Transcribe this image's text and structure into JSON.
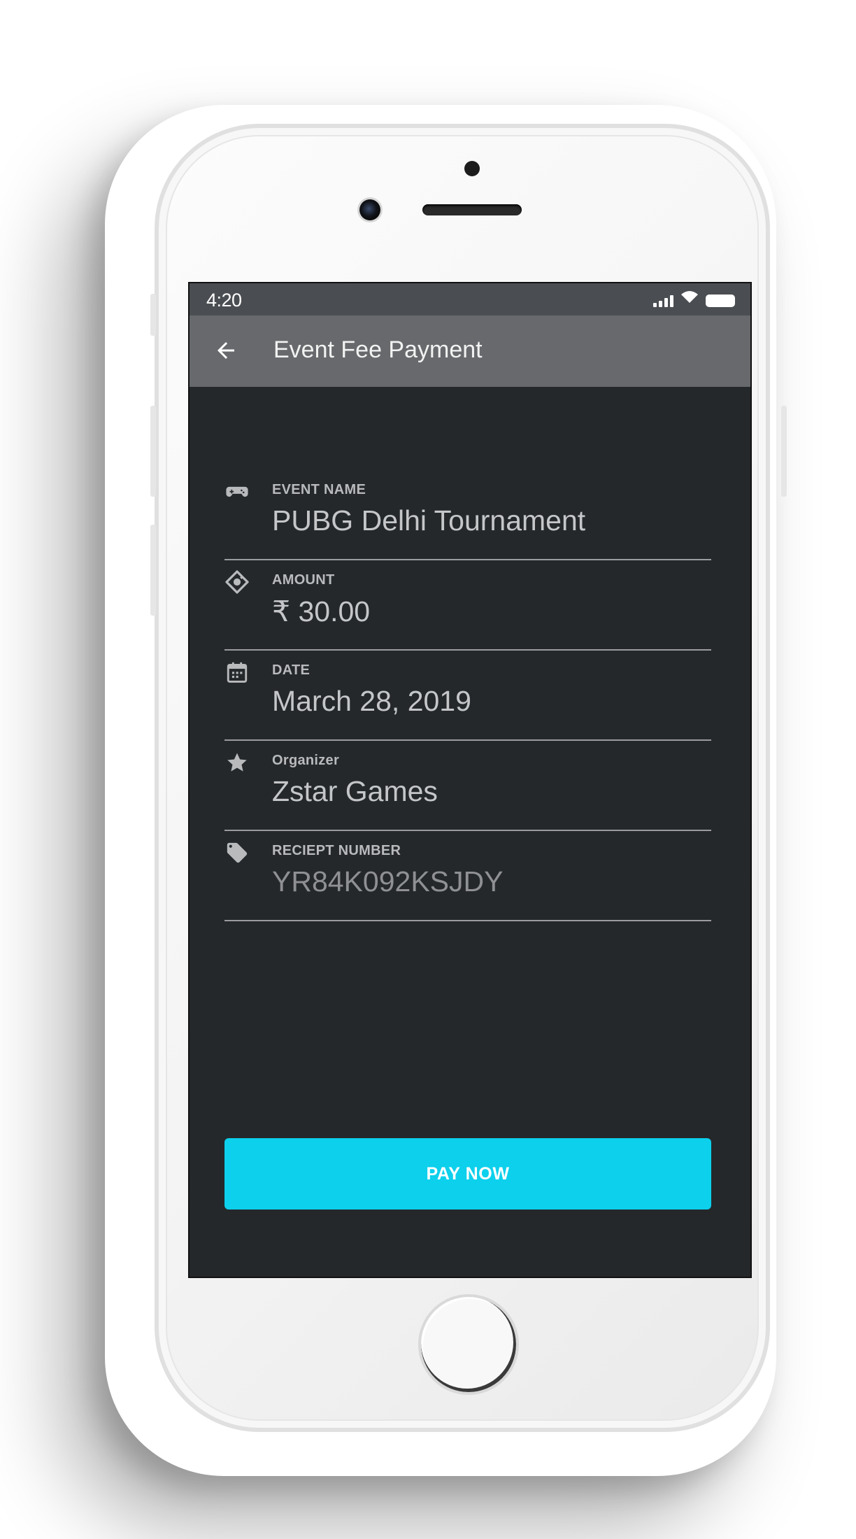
{
  "status_bar": {
    "time": "4:20",
    "icons": [
      "signal-icon",
      "wifi-icon",
      "battery-icon"
    ]
  },
  "app_bar": {
    "back_icon": "arrow-left-icon",
    "title": "Event Fee Payment"
  },
  "fields": [
    {
      "icon": "gamepad-icon",
      "label": "EVENT NAME",
      "value": "PUBG Delhi Tournament"
    },
    {
      "icon": "ticket-icon",
      "label": "AMOUNT",
      "value": "₹ 30.00"
    },
    {
      "icon": "calendar-icon",
      "label": "DATE",
      "value": "March 28, 2019"
    },
    {
      "icon": "star-icon",
      "label": "Organizer",
      "value": "Zstar Games"
    },
    {
      "icon": "tag-icon",
      "label": "RECIEPT NUMBER",
      "value": "YR84K092KSJDY"
    }
  ],
  "pay_button": {
    "label": "PAY NOW"
  },
  "colors": {
    "accent": "#0cd0ec",
    "screen_bg": "#25282b",
    "app_bar_bg": "#67696c",
    "status_bar_bg": "#4a4d51"
  }
}
